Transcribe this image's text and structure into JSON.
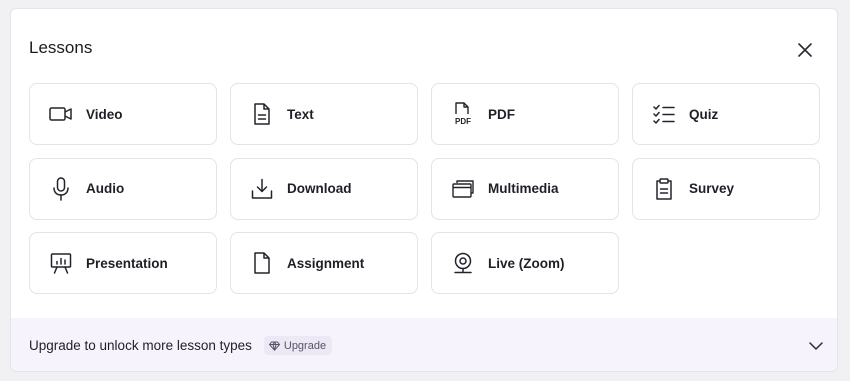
{
  "modal": {
    "title": "Lessons",
    "close_icon": "close-icon"
  },
  "lesson_types": [
    {
      "label": "Video",
      "icon": "video-camera-icon"
    },
    {
      "label": "Text",
      "icon": "text-document-icon"
    },
    {
      "label": "PDF",
      "icon": "pdf-icon",
      "icon_text": "PDF"
    },
    {
      "label": "Quiz",
      "icon": "checklist-icon"
    },
    {
      "label": "Audio",
      "icon": "microphone-icon"
    },
    {
      "label": "Download",
      "icon": "download-icon"
    },
    {
      "label": "Multimedia",
      "icon": "stacked-windows-icon"
    },
    {
      "label": "Survey",
      "icon": "clipboard-icon"
    },
    {
      "label": "Presentation",
      "icon": "presentation-board-icon"
    },
    {
      "label": "Assignment",
      "icon": "blank-document-icon"
    },
    {
      "label": "Live (Zoom)",
      "icon": "webcam-icon"
    }
  ],
  "footer": {
    "text": "Upgrade to unlock more lesson types",
    "badge_label": "Upgrade",
    "badge_icon": "gem-icon",
    "expand_icon": "chevron-down-icon"
  },
  "colors": {
    "page_bg": "#f1f1f4",
    "tile_border": "#e3e3e8",
    "footer_bg": "#f7f3fc",
    "badge_bg": "#ece8f4",
    "text": "#1b1b22"
  }
}
